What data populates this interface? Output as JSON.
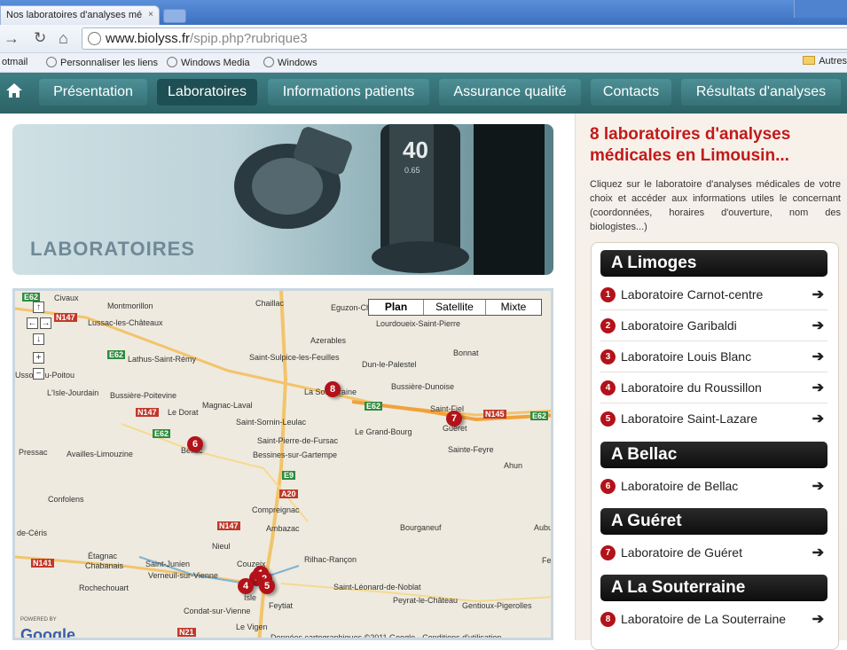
{
  "browser": {
    "tab_title": "Nos laboratoires d'analyses mé",
    "tab_close": "×",
    "url_host": "www.biolyss.fr",
    "url_path": "/spip.php?rubrique3",
    "bookmarks": [
      "otmail",
      "Personnaliser les liens",
      "Windows Media",
      "Windows"
    ],
    "other_bookmarks": "Autres"
  },
  "nav": {
    "items": [
      "Présentation",
      "Laboratoires",
      "Informations patients",
      "Assurance qualité",
      "Contacts",
      "Résultats d'analyses"
    ],
    "active_index": 1
  },
  "banner": {
    "title": "LABORATOIRES"
  },
  "map": {
    "types": [
      "Plan",
      "Satellite",
      "Mixte"
    ],
    "selected_type": "Plan",
    "controls": [
      "↑",
      "←",
      "→",
      "↓",
      "+",
      "−"
    ],
    "places": [
      "Civaux",
      "Montmorillon",
      "Chaillac",
      "Eguzon-Ch",
      "Lussac-les-Châteaux",
      "Lourdoueix-Saint-Pierre",
      "Azerables",
      "Lathus-Saint-Rémy",
      "Saint-Sulpice-les-Feuilles",
      "Bonnat",
      "Dun-le-Palestel",
      "Usson-du-Poitou",
      "L'Isle-Jourdain",
      "Bussière-Poitevine",
      "Magnac-Laval",
      "La Souterraine",
      "Bussière-Dunoise",
      "Le Dorat",
      "Saint-Sornin-Leulac",
      "Saint-Fiel",
      "Le Grand-Bourg",
      "Guéret",
      "Saint-Pierre-de-Fursac",
      "Bessines-sur-Gartempe",
      "Pressac",
      "Availles-Limouzine",
      "Bellac",
      "Sainte-Feyre",
      "Ahun",
      "Confolens",
      "Compreignac",
      "Bourganeuf",
      "Aubu",
      "de-Céris",
      "Nieul",
      "Étagnac",
      "Rilhac-Rançon",
      "Ambazac",
      "Chabanais",
      "Saint-Junien",
      "Couzeix",
      "Verneuil-sur-Vienne",
      "Rochechouart",
      "Saint-Léonard-de-Noblat",
      "Feytiat",
      "Isle",
      "Peyrat-le-Château",
      "Gentioux-Pigerolles",
      "Condat-sur-Vienne",
      "Le Vigen",
      "Fe"
    ],
    "roads_red": [
      "N147",
      "N147",
      "N145",
      "A20",
      "N147",
      "N141",
      "N21"
    ],
    "roads_green": [
      "E62",
      "E62",
      "E62",
      "E62",
      "E62",
      "E9"
    ],
    "powered_by": "POWERED BY",
    "google": "Google",
    "credits": "Données cartographiques ©2011 Google - Conditions d'utilisation",
    "markers": [
      "1",
      "2",
      "3",
      "4",
      "5",
      "6",
      "7",
      "8"
    ]
  },
  "right": {
    "title": "8 laboratoires d'analyses médicales en Limousin...",
    "description": "Cliquez sur le laboratoire d'analyses médicales de votre choix et accéder aux informations utiles le concernant (coordonnées, horaires d'ouverture, nom des biologistes...)",
    "arrow": "➔",
    "groups": [
      {
        "header": "A Limoges",
        "labs": [
          {
            "num": "1",
            "name": "Laboratoire Carnot-centre"
          },
          {
            "num": "2",
            "name": "Laboratoire Garibaldi"
          },
          {
            "num": "3",
            "name": "Laboratoire Louis Blanc"
          },
          {
            "num": "4",
            "name": "Laboratoire du Roussillon"
          },
          {
            "num": "5",
            "name": "Laboratoire Saint-Lazare"
          }
        ]
      },
      {
        "header": "A Bellac",
        "labs": [
          {
            "num": "6",
            "name": "Laboratoire de Bellac"
          }
        ]
      },
      {
        "header": "A Guéret",
        "labs": [
          {
            "num": "7",
            "name": "Laboratoire de Guéret"
          }
        ]
      },
      {
        "header": "A La Souterraine",
        "labs": [
          {
            "num": "8",
            "name": "Laboratoire de La Souterraine"
          }
        ]
      }
    ]
  }
}
